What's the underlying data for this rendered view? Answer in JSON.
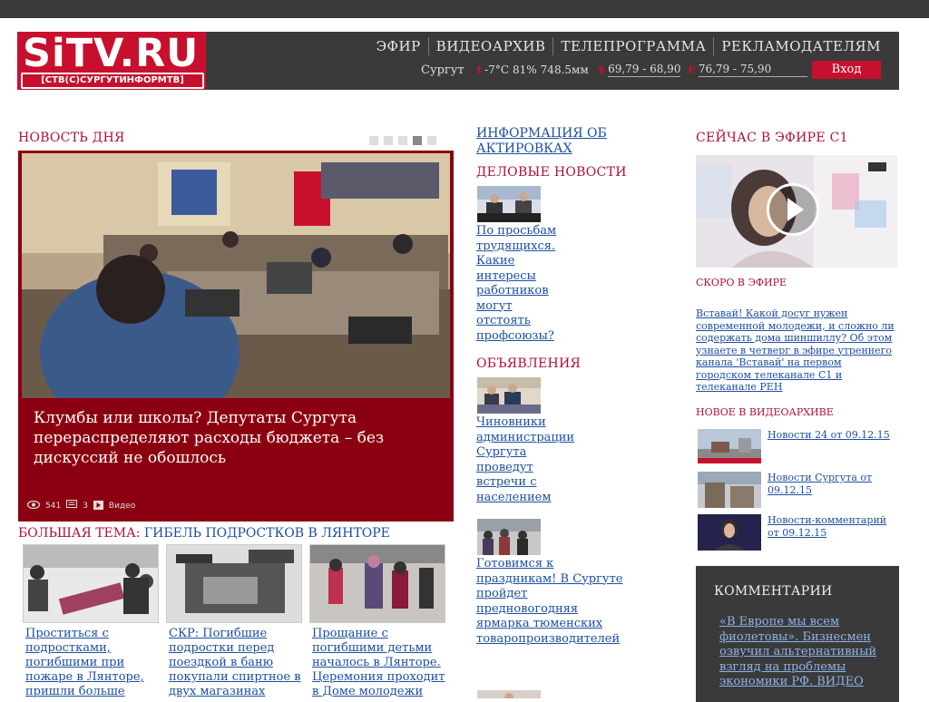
{
  "logo": {
    "main": "SiTV.RU",
    "sub": "[СТВ(С)СУРГУТИНФОРМТВ]"
  },
  "nav": [
    "ЭФИР",
    "ВИДЕОАРХИВ",
    "ТЕЛЕПРОГРАММА",
    "РЕКЛАМОДАТЕЛЯМ"
  ],
  "info": {
    "city": "Сургут",
    "temp_symbol": "t",
    "temp": "-7°C",
    "humidity": "81%",
    "pressure": "748.5мм",
    "usd_symbol": "$",
    "usd": "69,79 - 68,90",
    "eur_symbol": "€",
    "eur": "76,79 - 75,90",
    "login": "Вход"
  },
  "news_day": {
    "title": "НОВОСТЬ ДНЯ",
    "headline": "Клумбы или школы? Депутаты Сургута перераспределяют расходы бюджета – без дискуссий не обошлось",
    "views": "541",
    "comments": "3",
    "video": "Видео"
  },
  "big_theme": {
    "label": "БОЛЬШАЯ ТЕМА:",
    "link": "ГИБЕЛЬ ПОДРОСТКОВ В ЛЯНТОРЕ",
    "stories": [
      "Проститься с подростками, погибшими при пожаре в Лянторе, пришли больше",
      "СКР: Погибшие подростки перед поездкой в баню покупали спиртное в двух магазинах",
      "Прощание с погибшими детьми началось в Лянторе. Церемония проходит в Доме молодежи"
    ]
  },
  "middle": {
    "info_link": "ИНФОРМАЦИЯ ОБ АКТИРОВКАХ",
    "business_title": "ДЕЛОВЫЕ НОВОСТИ",
    "business_link": "По просьбам трудящихся. Какие интересы работников могут отстоять профсоюзы?",
    "ads_title": "ОБЪЯВЛЕНИЯ",
    "ads_link1": "Чиновники администрации Сургута проведут встречи с населением",
    "ads_link2": "Готовимся к праздникам! В Сургуте пройдет предновогодняя ярмарка тюменских товаропроизводителей"
  },
  "right": {
    "onair_title": "СЕЙЧАС В ЭФИРЕ С1",
    "soon_title": "СКОРО В ЭФИРЕ",
    "soon_text": "Вставай! Какой досуг нужен современной молодежи, и сложно ли содержать дома шиншиллу? Об этом узнаете в четверг в эфире утреннего канала 'Вставай' на первом городском телеканале С1 и телеканале РЕН",
    "archive_title": "НОВОЕ В ВИДЕОАРХИВЕ",
    "archive": [
      "Новости 24 от 09.12.15",
      "Новости Сургута от 09.12.15",
      "Новости-комментарий от 09.12.15"
    ],
    "comments_title": "КОММЕНТАРИИ",
    "comment_text": "«В Европе мы всем фиолетовы». Бизнесмен озвучил альтернативный взгляд на проблемы экономики РФ. ВИДЕО"
  },
  "colors": {
    "brand": "#c8102e",
    "dark": "#3a3a3a",
    "link": "#1c4fa0",
    "section": "#b0103a"
  }
}
